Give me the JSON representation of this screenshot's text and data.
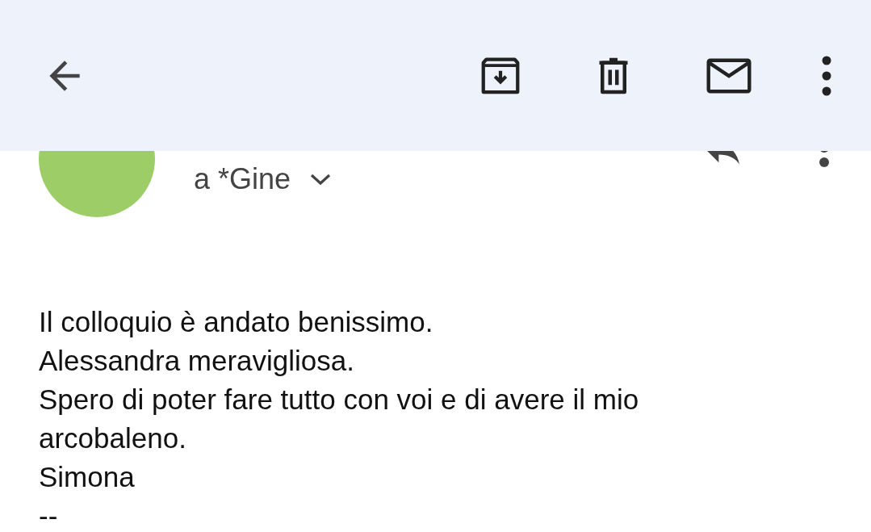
{
  "toolbar": {
    "actions": [
      {
        "kind": "archive"
      },
      {
        "kind": "delete"
      },
      {
        "kind": "unread"
      },
      {
        "kind": "more"
      }
    ]
  },
  "message": {
    "avatar": {
      "color": "#9ccd66"
    },
    "recipient": "a *Gine",
    "body": [
      "Il colloquio è andato benissimo.",
      "Alessandra meravigliosa.",
      "Spero di poter fare tutto con voi e di avere il mio arcobaleno.",
      "Simona",
      "--"
    ]
  }
}
